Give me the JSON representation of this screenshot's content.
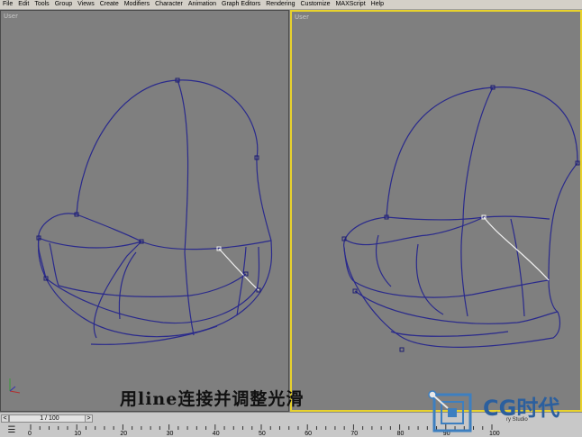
{
  "menubar": {
    "items": [
      "File",
      "Edit",
      "Tools",
      "Group",
      "Views",
      "Create",
      "Modifiers",
      "Character",
      "Animation",
      "Graph Editors",
      "Rendering",
      "Customize",
      "MAXScript",
      "Help"
    ]
  },
  "viewports": {
    "left": {
      "label": "User"
    },
    "right": {
      "label": "User"
    }
  },
  "caption": "用line连接并调整光滑",
  "timebar": {
    "frame_display": "1 / 100",
    "prev_arrow": "<",
    "next_arrow": ">",
    "ticks": [
      "0",
      "10",
      "20",
      "30",
      "40",
      "50",
      "60",
      "70",
      "80",
      "90",
      "100"
    ]
  },
  "watermark": {
    "logo_text": "CG时代",
    "subtext": "ry Studio"
  },
  "colors": {
    "spline": "#2a2a8c",
    "selected_spline": "#f0f0f0",
    "viewport_bg": "#7f7f7f",
    "active_border": "#e8d22c"
  }
}
